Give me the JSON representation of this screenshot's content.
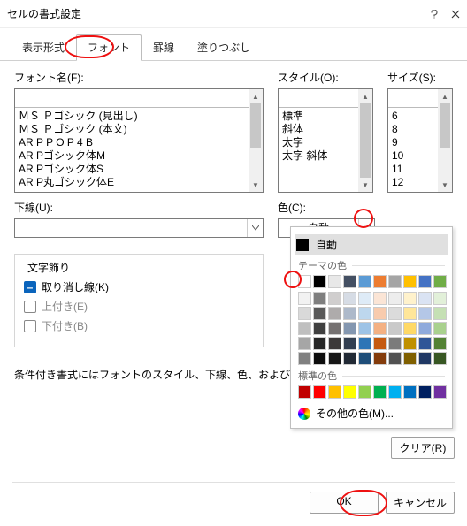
{
  "title": "セルの書式設定",
  "tabs": [
    "表示形式",
    "フォント",
    "罫線",
    "塗りつぶし"
  ],
  "activeTab": 1,
  "labels": {
    "fontName": "フォント名(F):",
    "style": "スタイル(O):",
    "size": "サイズ(S):",
    "underline": "下線(U):",
    "color": "色(C):",
    "decoration": "文字飾り",
    "strike": "取り消し線(K)",
    "superscript": "上付き(E)",
    "subscript": "下付き(B)"
  },
  "fontList": [
    "ＭＳ Ｐゴシック (見出し)",
    "ＭＳ Ｐゴシック (本文)",
    "AR P P O P 4 B",
    "AR Pゴシック体M",
    "AR Pゴシック体S",
    "AR P丸ゴシック体E"
  ],
  "styleList": [
    "標準",
    "斜体",
    "太字",
    "太字 斜体"
  ],
  "sizeList": [
    "6",
    "8",
    "9",
    "10",
    "11",
    "12"
  ],
  "colorCombo": "自動",
  "note": "条件付き書式にはフォントのスタイル、下線、色、および取り",
  "popup": {
    "auto": "自動",
    "themeHeader": "テーマの色",
    "standardHeader": "標準の色",
    "more": "その他の色(M)...",
    "themeTop": [
      "#ffffff",
      "#000000",
      "#e8e8e8",
      "#445063",
      "#5b9bd5",
      "#ed7d31",
      "#a5a5a5",
      "#ffc000",
      "#4472c4",
      "#70ad47"
    ],
    "themeShades": [
      [
        "#f2f2f2",
        "#7f7f7f",
        "#d0cece",
        "#d6dce5",
        "#deebf7",
        "#fbe5d6",
        "#ededed",
        "#fff2cc",
        "#dae3f3",
        "#e2f0d9"
      ],
      [
        "#d9d9d9",
        "#595959",
        "#aeabab",
        "#adb9ca",
        "#bdd7ee",
        "#f8cbad",
        "#dbdbdb",
        "#ffe699",
        "#b4c7e7",
        "#c5e0b4"
      ],
      [
        "#bfbfbf",
        "#404040",
        "#757171",
        "#8497b0",
        "#9dc3e6",
        "#f4b183",
        "#c9c9c9",
        "#ffd966",
        "#8faadc",
        "#a9d18e"
      ],
      [
        "#a6a6a6",
        "#262626",
        "#3b3838",
        "#333f50",
        "#2e75b6",
        "#c55a11",
        "#7b7b7b",
        "#bf9000",
        "#2f5597",
        "#548235"
      ],
      [
        "#808080",
        "#0d0d0d",
        "#171717",
        "#222a35",
        "#1f4e79",
        "#843c0c",
        "#525252",
        "#806000",
        "#203864",
        "#385723"
      ]
    ],
    "standard": [
      "#c00000",
      "#ff0000",
      "#ffc000",
      "#ffff00",
      "#92d050",
      "#00b050",
      "#00b0f0",
      "#0070c0",
      "#002060",
      "#7030a0"
    ]
  },
  "buttons": {
    "clear": "クリア(R)",
    "ok": "OK",
    "cancel": "キャンセル"
  }
}
